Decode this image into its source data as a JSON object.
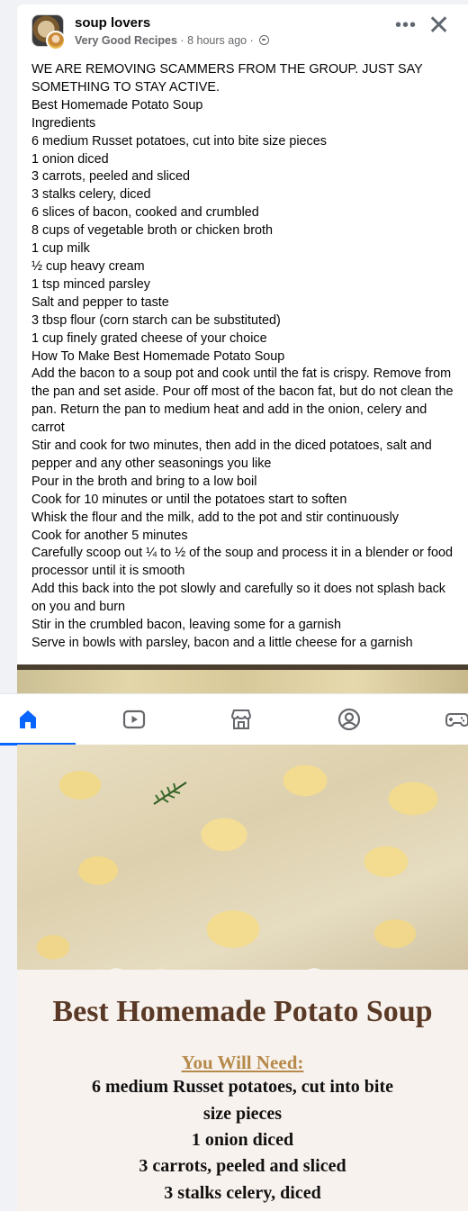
{
  "post": {
    "group_name": "soup lovers",
    "author": "Very Good Recipes",
    "separator": "·",
    "time": "8 hours ago",
    "time_separator": "·",
    "lines": [
      "WE ARE REMOVING SCAMMERS FROM THE GROUP. JUST SAY SOMETHING TO STAY ACTIVE.",
      "Best Homemade Potato Soup",
      "Ingredients",
      "6 medium Russet potatoes, cut into bite size pieces",
      "1 onion diced",
      "3 carrots, peeled and sliced",
      "3 stalks celery, diced",
      "6 slices of bacon, cooked and crumbled",
      "8 cups of vegetable broth or chicken broth",
      "1 cup milk",
      "½ cup heavy cream",
      "1 tsp minced parsley",
      "Salt and pepper to taste",
      "3 tbsp flour (corn starch can be substituted)",
      "1 cup finely grated cheese of your choice",
      "How To Make Best Homemade Potato Soup",
      "Add the bacon to a soup pot and cook until the fat is crispy. Remove from the pan and set aside. Pour off most of the bacon fat, but do not clean the pan. Return the pan to medium heat and add in the onion, celery and carrot",
      "Stir and cook for two minutes, then add in the diced potatoes, salt and pepper and any other seasonings you like",
      "Pour in the broth and bring to a low boil",
      "Cook for 10 minutes or until the potatoes start to soften",
      "Whisk the flour and the milk, add to the pot and stir continuously",
      "Cook for another 5 minutes",
      "Carefully scoop out ¼ to ½ of the soup and process it in a blender or food processor until it is smooth",
      "Add this back into the pot slowly and carefully so it does not splash back on you and burn",
      "Stir in the crumbled bacon, leaving some for a garnish",
      "Serve in bowls with parsley, bacon and a little cheese for a garnish"
    ]
  },
  "icons": {
    "more": "more-horizontal-icon",
    "close": "close-icon",
    "privacy": "globe-icon"
  },
  "nav": {
    "items": [
      "home-icon",
      "video-icon",
      "marketplace-icon",
      "profile-icon",
      "gaming-icon"
    ],
    "active_index": 0,
    "accent_color": "#0866ff"
  },
  "recipe_image": {
    "title": "Best Homemade Potato Soup",
    "subtitle": "You Will Need:",
    "lines": [
      "6 medium Russet potatoes, cut into bite",
      "size pieces",
      "1 onion diced",
      "3 carrots, peeled and sliced",
      "3 stalks celery, diced"
    ]
  }
}
